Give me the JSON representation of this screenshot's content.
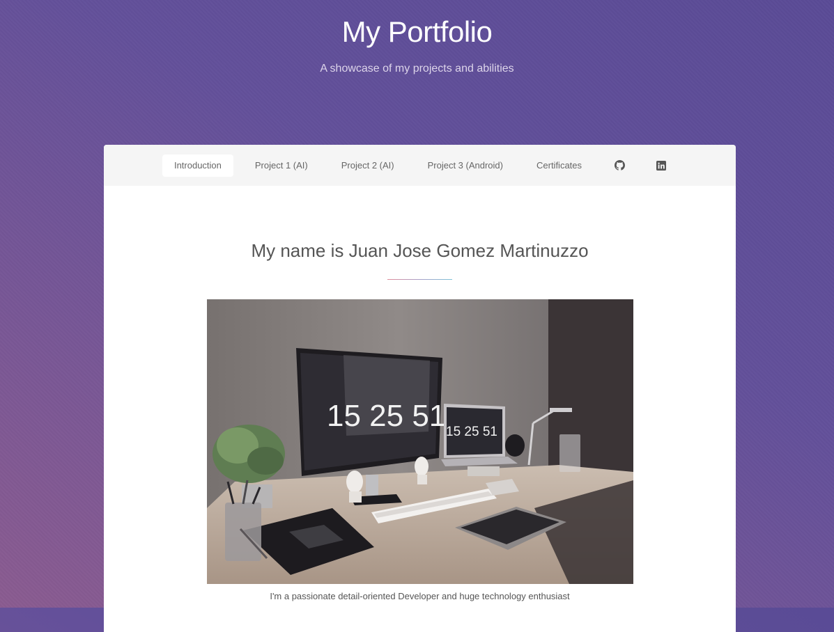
{
  "header": {
    "title": "My Portfolio",
    "tagline": "A showcase of my projects and abilities"
  },
  "nav": {
    "items": [
      {
        "label": "Introduction",
        "active": true
      },
      {
        "label": "Project 1 (AI)",
        "active": false
      },
      {
        "label": "Project 2 (AI)",
        "active": false
      },
      {
        "label": "Project 3 (Android)",
        "active": false
      },
      {
        "label": "Certificates",
        "active": false
      }
    ],
    "icons": [
      "github-icon",
      "linkedin-icon"
    ]
  },
  "intro": {
    "heading": "My name is Juan Jose Gomez Martinuzzo",
    "image_alt": "desk workspace photo",
    "monitor_clock": "15 25 51",
    "laptop_clock": "15 25 51",
    "caption": "I'm a passionate detail-oriented Developer and huge technology enthusiast"
  },
  "colors": {
    "background_start": "#5a4b96",
    "background_end": "#8a5b90",
    "card": "#ffffff",
    "navbar": "#f5f5f5"
  }
}
